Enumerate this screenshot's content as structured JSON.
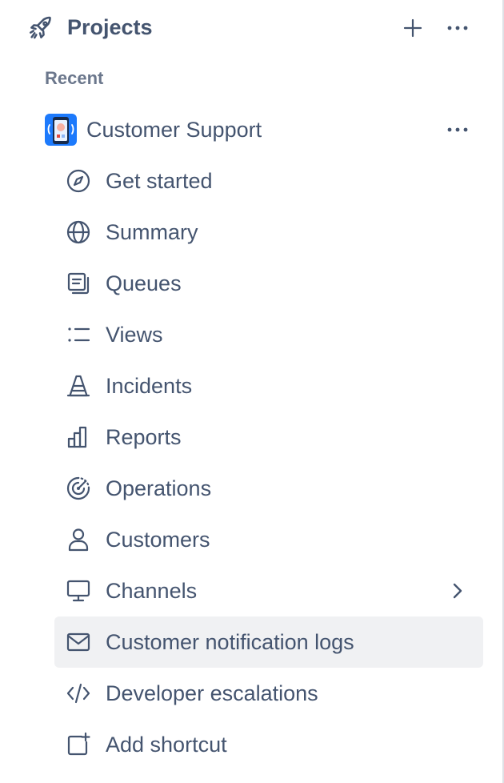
{
  "header": {
    "title": "Projects",
    "icon": "rocket-icon",
    "add_icon": "plus-icon",
    "more_icon": "more-horizontal-icon"
  },
  "section": {
    "recent_label": "Recent"
  },
  "project": {
    "name": "Customer Support",
    "avatar_icon": "project-avatar-icon",
    "more_icon": "more-horizontal-icon"
  },
  "nav": {
    "items": [
      {
        "label": "Get started",
        "icon": "compass-icon"
      },
      {
        "label": "Summary",
        "icon": "globe-icon"
      },
      {
        "label": "Queues",
        "icon": "queues-icon"
      },
      {
        "label": "Views",
        "icon": "list-icon"
      },
      {
        "label": "Incidents",
        "icon": "traffic-cone-icon"
      },
      {
        "label": "Reports",
        "icon": "bar-chart-icon"
      },
      {
        "label": "Operations",
        "icon": "radar-icon"
      },
      {
        "label": "Customers",
        "icon": "person-icon"
      },
      {
        "label": "Channels",
        "icon": "monitor-icon",
        "has_submenu": true
      },
      {
        "label": "Customer notification logs",
        "icon": "mail-icon",
        "selected": true
      },
      {
        "label": "Developer escalations",
        "icon": "code-icon"
      },
      {
        "label": "Add shortcut",
        "icon": "add-shortcut-icon"
      }
    ]
  },
  "colors": {
    "text": "#44546f",
    "muted": "#6b778c",
    "selected_bg": "#f0f1f3",
    "avatar_bg": "#1d7afc"
  }
}
